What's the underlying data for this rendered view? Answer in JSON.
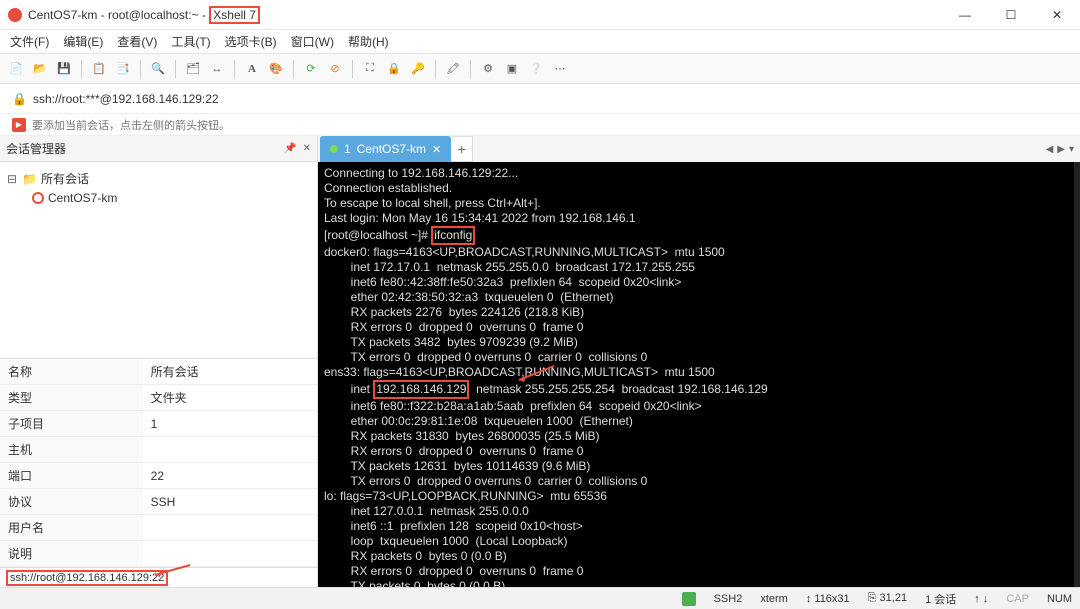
{
  "titlebar": {
    "session_name": "CentOS7-km",
    "user_host": "root@localhost:~",
    "app_name": "Xshell 7",
    "btn_min": "—",
    "btn_max": "☐",
    "btn_close": "✕"
  },
  "menubar": {
    "items": [
      "文件(F)",
      "编辑(E)",
      "查看(V)",
      "工具(T)",
      "选项卡(B)",
      "窗口(W)",
      "帮助(H)"
    ]
  },
  "address": {
    "url": "ssh://root:***@192.168.146.129:22"
  },
  "hint": {
    "text": "要添加当前会话，点击左侧的箭头按钮。"
  },
  "sidebar": {
    "title": "会话管理器",
    "tree": {
      "root_label": "所有会话",
      "child_label": "CentOS7-km"
    },
    "props": [
      {
        "k": "名称",
        "v": "所有会话"
      },
      {
        "k": "类型",
        "v": "文件夹"
      },
      {
        "k": "子项目",
        "v": "1"
      },
      {
        "k": "主机",
        "v": ""
      },
      {
        "k": "端口",
        "v": "22"
      },
      {
        "k": "协议",
        "v": "SSH"
      },
      {
        "k": "用户名",
        "v": ""
      },
      {
        "k": "说明",
        "v": ""
      }
    ],
    "footer_url": "ssh://root@192.168.146.129:22"
  },
  "content_tab": {
    "index": "1",
    "label": "CentOS7-km"
  },
  "terminal": {
    "l1": "Connecting to 192.168.146.129:22...",
    "l2": "Connection established.",
    "l3": "To escape to local shell, press Ctrl+Alt+].",
    "l5": "Last login: Mon May 16 15:34:41 2022 from 192.168.146.1",
    "prompt": "[root@localhost ~]# ",
    "cmd": "ifconfig",
    "block1a": "docker0: flags=4163<UP,BROADCAST,RUNNING,MULTICAST>  mtu 1500",
    "block1b": "        inet 172.17.0.1  netmask 255.255.0.0  broadcast 172.17.255.255",
    "block1c": "        inet6 fe80::42:38ff:fe50:32a3  prefixlen 64  scopeid 0x20<link>",
    "block1d": "        ether 02:42:38:50:32:a3  txqueuelen 0  (Ethernet)",
    "block1e": "        RX packets 2276  bytes 224126 (218.8 KiB)",
    "block1f": "        RX errors 0  dropped 0  overruns 0  frame 0",
    "block1g": "        TX packets 3482  bytes 9709239 (9.2 MiB)",
    "block1h": "        TX errors 0  dropped 0 overruns 0  carrier 0  collisions 0",
    "block2a": "ens33: flags=4163<UP,BROADCAST,RUNNING,MULTICAST>  mtu 1500",
    "block2b_pre": "        inet ",
    "block2b_ip": "192.168.146.129",
    "block2b_post": "  netmask 255.255.255.254  broadcast 192.168.146.129",
    "block2c": "        inet6 fe80::f322:b28a:a1ab:5aab  prefixlen 64  scopeid 0x20<link>",
    "block2d": "        ether 00:0c:29:81:1e:08  txqueuelen 1000  (Ethernet)",
    "block2e": "        RX packets 31830  bytes 26800035 (25.5 MiB)",
    "block2f": "        RX errors 0  dropped 0  overruns 0  frame 0",
    "block2g": "        TX packets 12631  bytes 10114639 (9.6 MiB)",
    "block2h": "        TX errors 0  dropped 0 overruns 0  carrier 0  collisions 0",
    "block3a": "lo: flags=73<UP,LOOPBACK,RUNNING>  mtu 65536",
    "block3b": "        inet 127.0.0.1  netmask 255.0.0.0",
    "block3c": "        inet6 ::1  prefixlen 128  scopeid 0x10<host>",
    "block3d": "        loop  txqueuelen 1000  (Local Loopback)",
    "block3e": "        RX packets 0  bytes 0 (0.0 B)",
    "block3f": "        RX errors 0  dropped 0  overruns 0  frame 0",
    "block3g": "        TX packets 0  bytes 0 (0.0 B)"
  },
  "statusbar": {
    "ssh": "SSH2",
    "term": "xterm",
    "size": "116x31",
    "pos": "31,21",
    "sessions": "1 会话",
    "cap": "CAP",
    "num": "NUM"
  }
}
